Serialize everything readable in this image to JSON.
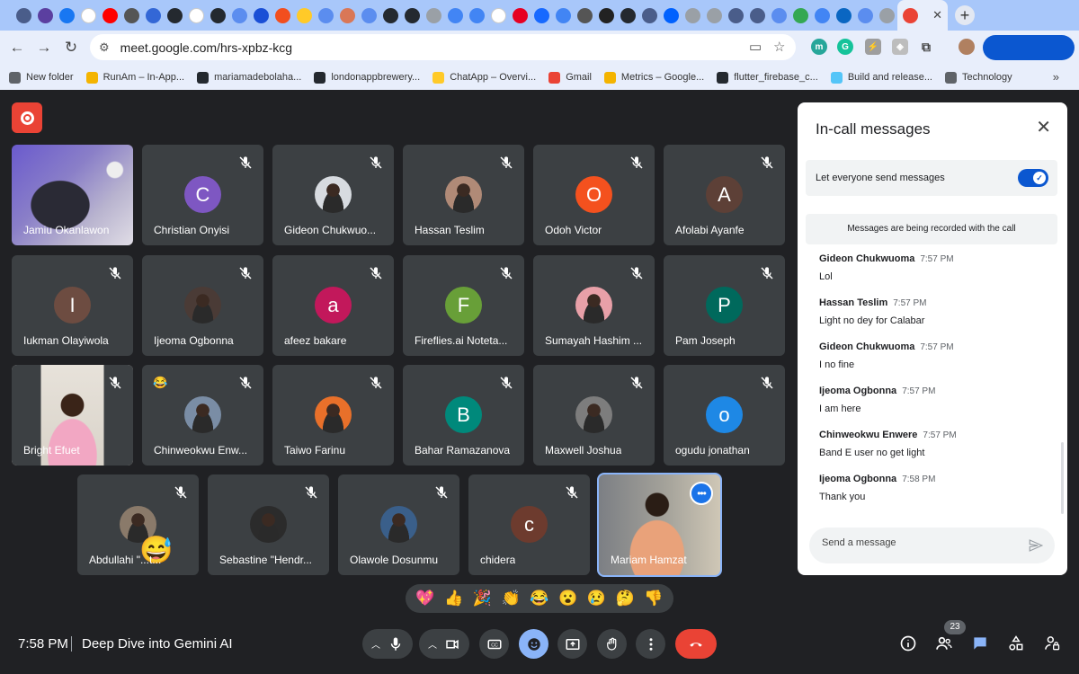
{
  "browser": {
    "tab_favicons": [
      {
        "icon": "circle-icon",
        "color": "#4a5d8a"
      },
      {
        "icon": "grid-icon",
        "color": "#5b3fa0"
      },
      {
        "icon": "butterfly-icon",
        "color": "#1877f2"
      },
      {
        "icon": "google-icon",
        "color": "#ffffff"
      },
      {
        "icon": "youtube-icon",
        "color": "#ff0000"
      },
      {
        "icon": "target-icon",
        "color": "#555555"
      },
      {
        "icon": "swirl-icon",
        "color": "#3367d6"
      },
      {
        "icon": "github-icon",
        "color": "#24292f"
      },
      {
        "icon": "google-icon",
        "color": "#ffffff"
      },
      {
        "icon": "github-icon",
        "color": "#24292f"
      },
      {
        "icon": "gemini-icon",
        "color": "#5b8def"
      },
      {
        "icon": "qr-icon",
        "color": "#1a4fd6"
      },
      {
        "icon": "figma-icon",
        "color": "#f24e1e"
      },
      {
        "icon": "firebase-icon",
        "color": "#ffca28"
      },
      {
        "icon": "gemini-icon",
        "color": "#5b8def"
      },
      {
        "icon": "asterisk-icon",
        "color": "#d97757"
      },
      {
        "icon": "gemini-icon",
        "color": "#5b8def"
      },
      {
        "icon": "github-icon",
        "color": "#24292f"
      },
      {
        "icon": "github-icon",
        "color": "#24292f"
      },
      {
        "icon": "circle-icon",
        "color": "#9aa0a6"
      },
      {
        "icon": "docs-icon",
        "color": "#4285f4"
      },
      {
        "icon": "docs-icon",
        "color": "#4285f4"
      },
      {
        "icon": "google-icon",
        "color": "#ffffff"
      },
      {
        "icon": "pinterest-icon",
        "color": "#e60023"
      },
      {
        "icon": "behance-icon",
        "color": "#1769ff"
      },
      {
        "icon": "docs-icon",
        "color": "#4285f4"
      },
      {
        "icon": "phone-icon",
        "color": "#555555"
      },
      {
        "icon": "stripe-icon",
        "color": "#222222"
      },
      {
        "icon": "github-icon",
        "color": "#24292f"
      },
      {
        "icon": "circle-icon",
        "color": "#4a5d8a"
      },
      {
        "icon": "dropbox-icon",
        "color": "#0061fe"
      },
      {
        "icon": "circle-icon",
        "color": "#9aa0a6"
      },
      {
        "icon": "circle-icon",
        "color": "#9aa0a6"
      },
      {
        "icon": "circle-icon",
        "color": "#4a5d8a"
      },
      {
        "icon": "circle-icon",
        "color": "#4a5d8a"
      },
      {
        "icon": "gemini-icon",
        "color": "#5b8def"
      },
      {
        "icon": "plus-circle-icon",
        "color": "#34a853"
      },
      {
        "icon": "calendar-icon",
        "color": "#4285f4"
      },
      {
        "icon": "linkedin-icon",
        "color": "#0a66c2"
      },
      {
        "icon": "gemini-icon",
        "color": "#5b8def"
      },
      {
        "icon": "circle-icon",
        "color": "#9aa0a6"
      },
      {
        "icon": "gmail-icon",
        "color": "#ea4335"
      }
    ],
    "url": "meet.google.com/hrs-xpbz-kcg",
    "bookmarks": [
      {
        "label": "New folder",
        "color": "#5f6368"
      },
      {
        "label": "RunAm – In-App...",
        "color": "#f4b400"
      },
      {
        "label": "mariamadebolaha...",
        "color": "#24292f"
      },
      {
        "label": "londonappbrewery...",
        "color": "#24292f"
      },
      {
        "label": "ChatApp – Overvi...",
        "color": "#ffca28"
      },
      {
        "label": "Gmail",
        "color": "#ea4335"
      },
      {
        "label": "Metrics – Google...",
        "color": "#f4b400"
      },
      {
        "label": "flutter_firebase_c...",
        "color": "#24292f"
      },
      {
        "label": "Build and release...",
        "color": "#54c5f8"
      },
      {
        "label": "Technology",
        "color": "#5f6368"
      }
    ],
    "bookmarks_more": "»"
  },
  "meet": {
    "participants": [
      {
        "name": "Jamiu Okanlawon",
        "type": "video"
      },
      {
        "name": "Christian Onyisi",
        "initial": "C",
        "color": "#7e57c2"
      },
      {
        "name": "Gideon Chukwuo...",
        "type": "photo",
        "color": "#d7dbe0"
      },
      {
        "name": "Hassan Teslim",
        "type": "photo",
        "color": "#b08a77"
      },
      {
        "name": "Odoh Victor",
        "initial": "O",
        "color": "#f4511e"
      },
      {
        "name": "Afolabi Ayanfe",
        "initial": "A",
        "color": "#5d4037"
      },
      {
        "name": "Iukman Olayiwola",
        "initial": "I",
        "color": "#6d4c41"
      },
      {
        "name": "Ijeoma Ogbonna",
        "type": "photo",
        "color": "#4a3b36"
      },
      {
        "name": "afeez bakare",
        "initial": "a",
        "color": "#c2185b"
      },
      {
        "name": "Fireflies.ai Noteta...",
        "initial": "F",
        "color": "#689f38"
      },
      {
        "name": "Sumayah Hashim ...",
        "type": "photo",
        "color": "#e8a0a8"
      },
      {
        "name": "Pam Joseph",
        "initial": "P",
        "color": "#00695c"
      },
      {
        "name": "Bright Efuet",
        "type": "video"
      },
      {
        "name": "Chinweokwu Enw...",
        "type": "photo",
        "color": "#7a8da5",
        "emoji": "😂"
      },
      {
        "name": "Taiwo Farinu",
        "type": "photo",
        "color": "#e8702a"
      },
      {
        "name": "Bahar Ramazanova",
        "initial": "B",
        "color": "#00897b"
      },
      {
        "name": "Maxwell Joshua",
        "type": "photo",
        "color": "#7d7d7d"
      },
      {
        "name": "ogudu jonathan",
        "initial": "o",
        "color": "#1e88e5"
      },
      {
        "name": "Abdullahi \"...t...",
        "type": "photo",
        "color": "#8a7a6a",
        "emoji": "😅"
      },
      {
        "name": "Sebastine \"Hendr...",
        "type": "photo",
        "color": "#2b2b2b"
      },
      {
        "name": "Olawole Dosunmu",
        "type": "photo",
        "color": "#3a5f8a"
      },
      {
        "name": "chidera",
        "initial": "c",
        "color": "#6d3b2e"
      },
      {
        "name": "Mariam Hamzat",
        "type": "video",
        "self": true
      }
    ],
    "reactions": [
      "💖",
      "👍",
      "🎉",
      "👏",
      "😂",
      "😮",
      "😢",
      "🤔",
      "👎"
    ],
    "time": "7:58 PM",
    "title": "Deep Dive into Gemini AI",
    "people_count": "23"
  },
  "panel": {
    "title": "In-call messages",
    "permission_label": "Let everyone send messages",
    "permission_on": true,
    "recording_note": "Messages are being recorded with the call",
    "messages": [
      {
        "sender": "Gideon Chukwuoma",
        "time": "7:57 PM",
        "text": "Lol"
      },
      {
        "sender": "Hassan Teslim",
        "time": "7:57 PM",
        "text": "Light no dey for Calabar"
      },
      {
        "sender": "Gideon Chukwuoma",
        "time": "7:57 PM",
        "text": "I no fine"
      },
      {
        "sender": "Ijeoma Ogbonna",
        "time": "7:57 PM",
        "text": "I am here"
      },
      {
        "sender": "Chinweokwu Enwere",
        "time": "7:57 PM",
        "text": "Band E user no get light"
      },
      {
        "sender": "Ijeoma Ogbonna",
        "time": "7:58 PM",
        "text": "Thank you"
      }
    ],
    "composer_placeholder": "Send a message"
  },
  "colors": {
    "background": "#202124",
    "tile": "#3c4043",
    "accent": "#8ab4f8",
    "hangup": "#ea4335",
    "toggle": "#0b57d0"
  }
}
